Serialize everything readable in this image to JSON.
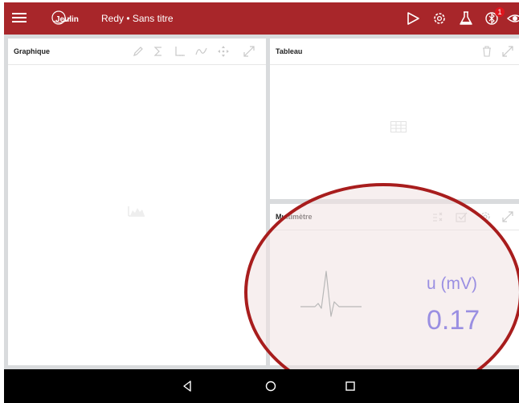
{
  "app": {
    "logo_text": "Jeulin",
    "title": "Redy • Sans titre"
  },
  "topbar": {
    "notification_count": "1"
  },
  "panels": {
    "graphique": {
      "title": "Graphique"
    },
    "tableau": {
      "title": "Tableau"
    },
    "multimetre": {
      "title": "Multimètre",
      "quantity": "u (mV)",
      "value": "0.17"
    }
  },
  "colors": {
    "appbar": "#a8262a",
    "annotation": "#a81d1d",
    "reading": "#9a8fe2"
  }
}
